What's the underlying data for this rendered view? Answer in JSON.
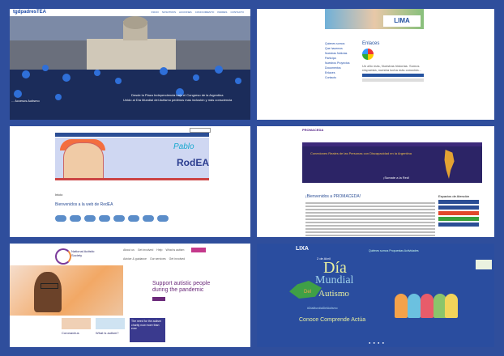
{
  "tiles": {
    "t1": {
      "logo": "tgdpadresTEA",
      "nav": [
        "INICIO",
        "NOSOTROS",
        "ACCIONES",
        "CONOCIMIENTO",
        "PADRES",
        "CONTACTO"
      ],
      "caption1": "Desde la Plaza Independencia bajo el Congreso de la Argentina",
      "caption2": "Unido al Día Mundial del Autismo pedimos mas inclusión y más consciencia",
      "caption3": "... Accesos Autismo"
    },
    "t2": {
      "logo": "LIMA",
      "menu": [
        "Quienes somos",
        "Que hacemos",
        "Nuestras Noticias",
        "Participa",
        "Nuestros Proyectos",
        "Documentos",
        "Enlaces",
        "Contacto"
      ],
      "heading": "Enlaces",
      "blurb": "Un año más, Nuestras historias. Somos respuesta, nuestra lucha más conocida..."
    },
    "t3": {
      "brand": "RodEA",
      "pablo": "Pablo",
      "inicio": "Inicio",
      "welcome": "Bienvenidos a la web de RedEA"
    },
    "t4": {
      "logo": "PROMACEDA",
      "hero": "Conexiones Reales de las Personas con Discapacidad en la Argentina",
      "button": "¡Sumate a la Red!",
      "welcome": "¡Bienvenidos a PROMACEDA!",
      "sidebar_title": "Espacios de Atención"
    },
    "t5": {
      "org": "National Autistic Society",
      "nav": [
        "About us",
        "Get involved",
        "Help",
        "What is autism",
        "Donate"
      ],
      "nav2": [
        "Advice & guidance",
        "Our services",
        "Get involved"
      ],
      "headline": "Support autistic people during the pandemic",
      "cards": [
        "Coronavirus",
        "What is autism?"
      ],
      "quote": "The need for the autism charity now more than ever"
    },
    "t6": {
      "logo": "LIXA",
      "nav": "Quiénes somos   Propuestas   Actividades",
      "small": "2 de Abril",
      "dia": "Día",
      "mundial": "Mundial",
      "del": "Del",
      "autismo": "Autismo",
      "tagline": "#DíaMundialDelAutismo",
      "motto": "Conoce   Comprende   Actúa",
      "dots": "● ● ● ●"
    }
  }
}
